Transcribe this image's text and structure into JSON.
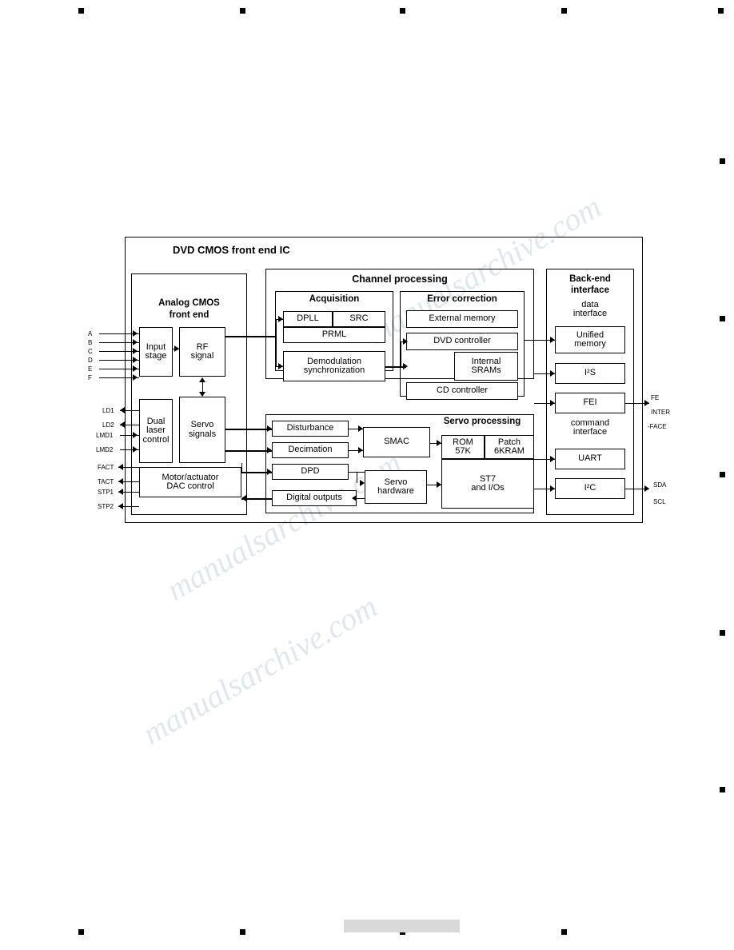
{
  "title": "DVD CMOS front end IC block diagram",
  "watermark": "manualsarchive.com",
  "diagram": {
    "outer_label": "DVD CMOS front end IC",
    "analog": {
      "title_line1": "Analog CMOS",
      "title_line2": "front end",
      "input_stage": "Input\nstage",
      "rf_signal": "RF\nsignal",
      "dual_laser": "Dual\nlaser\ncontrol",
      "servo_signals": "Servo\nsignals",
      "motor_dac": "Motor/actuator\nDAC control"
    },
    "channel": {
      "title": "Channel processing",
      "acquisition": {
        "title": "Acquisition",
        "dpll": "DPLL",
        "src": "SRC",
        "prml": "PRML",
        "demod": "Demodulation\nsynchronization"
      },
      "error_correction": {
        "title": "Error correction",
        "external_memory": "External memory",
        "dvd_controller": "DVD controller",
        "internal_srams": "Internal\nSRAMs",
        "cd_controller": "CD controller"
      }
    },
    "servo": {
      "title": "Servo processing",
      "disturbance": "Disturbance",
      "decimation": "Decimation",
      "dpd": "DPD",
      "digital_outputs": "Digital outputs",
      "smac": "SMAC",
      "servo_hardware": "Servo\nhardware",
      "rom": "ROM\n57K",
      "patch": "Patch\n6KRAM",
      "st7": "ST7\nand I/Os"
    },
    "backend": {
      "title_line1": "Back-end",
      "title_line2": "interface",
      "data_interface": "data\ninterface",
      "unified_memory": "Unified\nmemory",
      "i2s": "I²S",
      "fei": "FEI",
      "command_interface": "command\ninterface",
      "uart": "UART",
      "i2c": "I²C"
    },
    "left_pins_top": [
      "A",
      "B",
      "C",
      "D",
      "E",
      "F"
    ],
    "left_pins_mid": [
      "LD1",
      "LD2",
      "LMD1",
      "LMD2"
    ],
    "left_pins_bottom": [
      "FACT",
      "TACT",
      "STP1",
      "STP2"
    ],
    "right_pins_fe": [
      "FE",
      "INTER",
      "-FACE"
    ],
    "right_pins_i2c": [
      "SDA",
      "SCL"
    ]
  }
}
